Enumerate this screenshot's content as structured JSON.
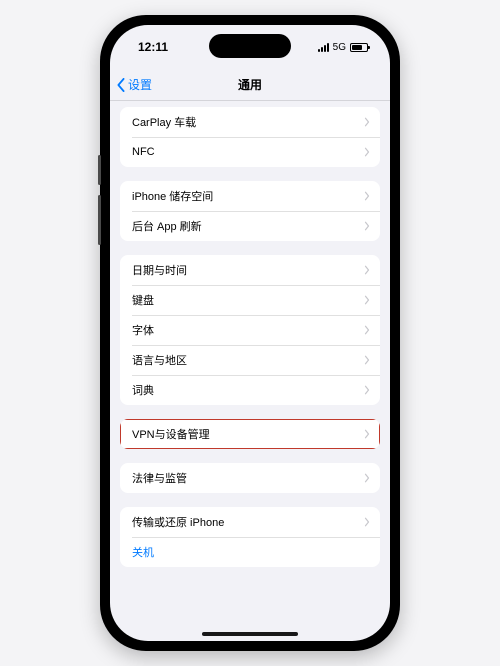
{
  "status": {
    "time": "12:11",
    "network": "5G"
  },
  "nav": {
    "back_label": "设置",
    "title": "通用"
  },
  "groups": {
    "g1": {
      "carplay": "CarPlay 车载",
      "nfc": "NFC"
    },
    "g2": {
      "storage": "iPhone 储存空间",
      "refresh": "后台 App 刷新"
    },
    "g3": {
      "datetime": "日期与时间",
      "keyboard": "键盘",
      "fonts": "字体",
      "lang": "语言与地区",
      "dict": "词典"
    },
    "g4": {
      "vpn": "VPN与设备管理"
    },
    "g5": {
      "legal": "法律与监管"
    },
    "g6": {
      "transfer": "传输或还原 iPhone",
      "shutdown": "关机"
    }
  }
}
